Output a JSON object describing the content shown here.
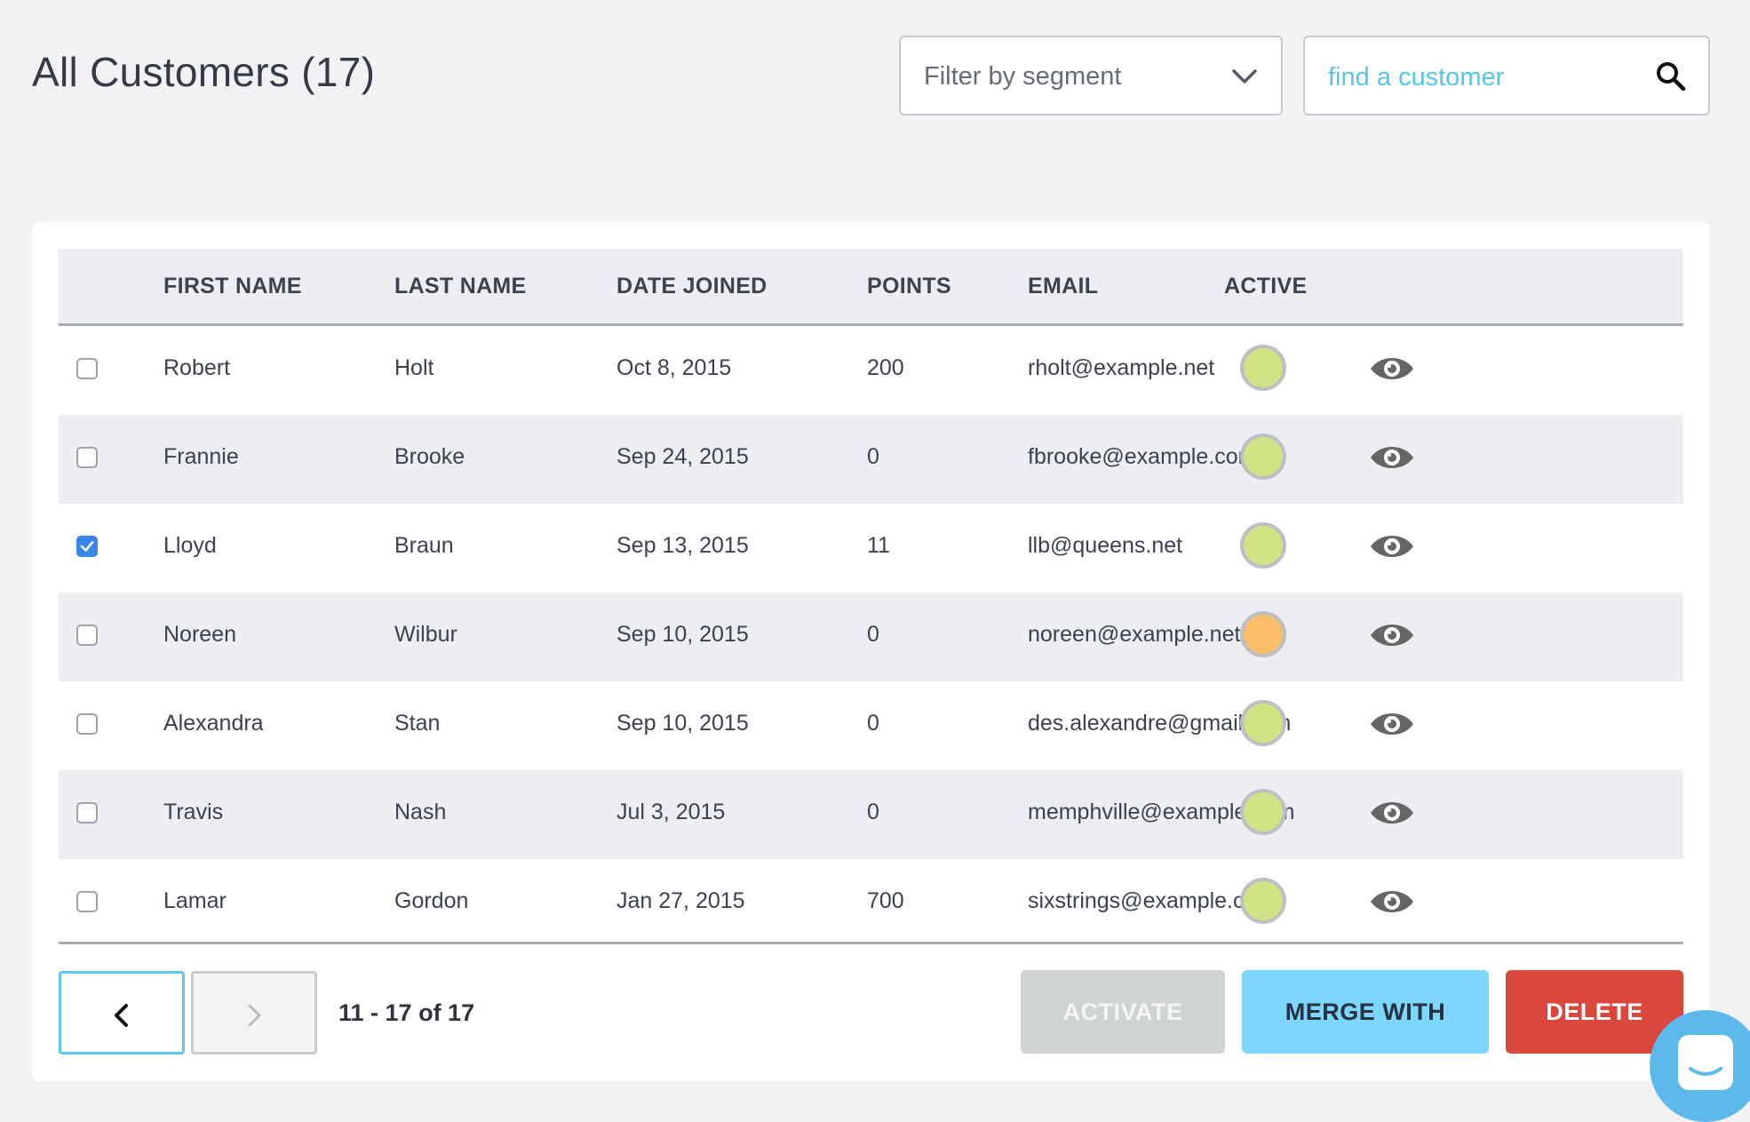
{
  "header": {
    "title": "All Customers (17)",
    "segment_filter_label": "Filter by segment",
    "search_placeholder": "find a customer"
  },
  "table": {
    "columns": [
      "FIRST NAME",
      "LAST NAME",
      "DATE JOINED",
      "POINTS",
      "EMAIL",
      "ACTIVE"
    ],
    "rows": [
      {
        "first": "Robert",
        "last": "Holt",
        "joined": "Oct 8, 2015",
        "points": "200",
        "email": "rholt@example.net",
        "checked": false,
        "status_color": "#cfe383"
      },
      {
        "first": "Frannie",
        "last": "Brooke",
        "joined": "Sep 24, 2015",
        "points": "0",
        "email": "fbrooke@example.com",
        "checked": false,
        "status_color": "#cfe383"
      },
      {
        "first": "Lloyd",
        "last": "Braun",
        "joined": "Sep 13, 2015",
        "points": "11",
        "email": "llb@queens.net",
        "checked": true,
        "status_color": "#cfe383"
      },
      {
        "first": "Noreen",
        "last": "Wilbur",
        "joined": "Sep 10, 2015",
        "points": "0",
        "email": "noreen@example.net",
        "checked": false,
        "status_color": "#fbbe68"
      },
      {
        "first": "Alexandra",
        "last": "Stan",
        "joined": "Sep 10, 2015",
        "points": "0",
        "email": "des.alexandre@gmail.com",
        "checked": false,
        "status_color": "#cfe383"
      },
      {
        "first": "Travis",
        "last": "Nash",
        "joined": "Jul 3, 2015",
        "points": "0",
        "email": "memphville@example.com",
        "checked": false,
        "status_color": "#cfe383"
      },
      {
        "first": "Lamar",
        "last": "Gordon",
        "joined": "Jan 27, 2015",
        "points": "700",
        "email": "sixstrings@example.com",
        "checked": false,
        "status_color": "#cfe383"
      }
    ]
  },
  "footer": {
    "pagination": "11 - 17 of 17",
    "activate_label": "ACTIVATE",
    "merge_label": "MERGE WITH",
    "delete_label": "DELETE"
  },
  "colors": {
    "accent_blue": "#5cc8ef",
    "checkbox_blue": "#3a86e6",
    "delete_red": "#d9473d",
    "merge_blue": "#7dd6fb"
  },
  "icons": {
    "segment_dropdown": "chevron-down-icon",
    "search": "search-icon",
    "row_view": "eye-icon",
    "prev": "chevron-left-icon",
    "next": "chevron-right-icon",
    "chat": "chat-icon"
  }
}
